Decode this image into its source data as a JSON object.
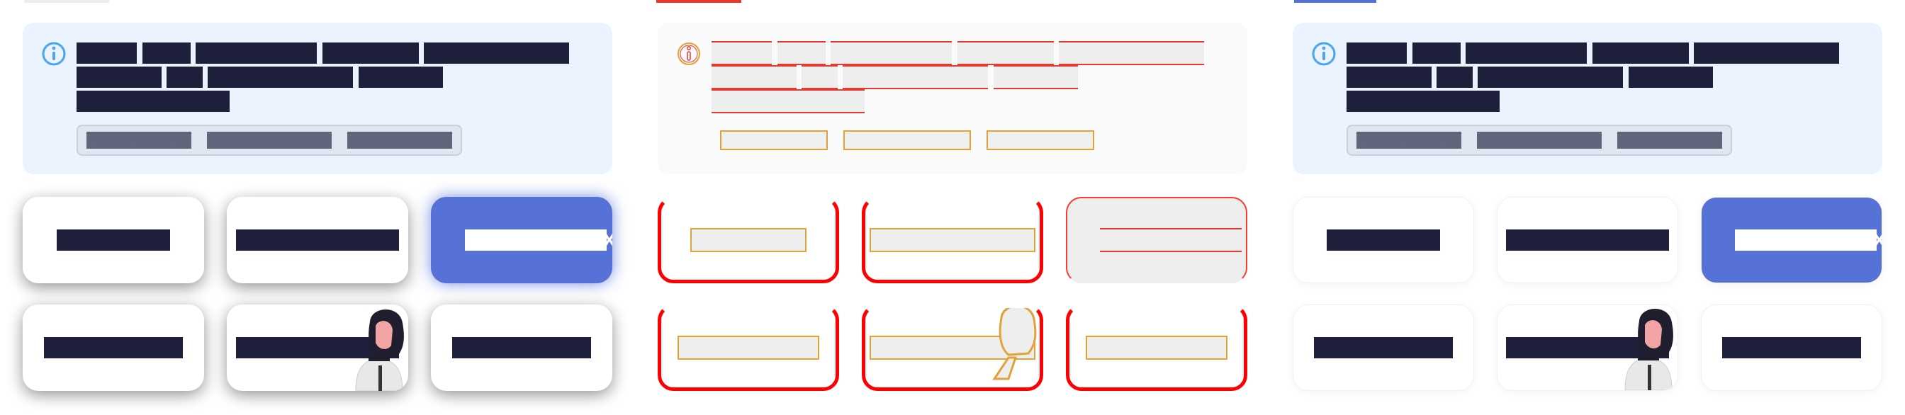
{
  "message_words": [
    "XXXXX",
    "XXXX",
    "XXXXXXXXXX",
    "XXXXXXXX",
    "XXXXXXXXXXXX",
    "XXXXXXX",
    "XXX",
    "XXXXXXXXXXXX",
    "XXXXXXX"
  ],
  "message_lead": "__",
  "message_tail": "XXXXXXXXXXX",
  "chips": [
    "XXXXXXXXXX",
    "XXXXXXXXXXXX",
    "XXXXXXXXXX"
  ],
  "tiles": [
    {
      "label": "XXXXXXXXX",
      "selected": false
    },
    {
      "label": "XXXXXXXXXXXXX",
      "selected": false
    },
    {
      "label": "XXXXXXXXXXXXX",
      "selected": true
    },
    {
      "label": "XXXXXXXXXXX",
      "selected": false
    },
    {
      "label": "XXXXXXXXXXXXX",
      "selected": false
    },
    {
      "label": "XXXXXXXXXXX",
      "selected": false
    }
  ],
  "colors": {
    "info_bg": "#eaf3fe",
    "info_icon": "#4aa3ee",
    "text_dark": "#1d1f3b",
    "chip_text": "#60667b",
    "accent_selected": "#5672d6",
    "diff_red": "#ff0000",
    "diff_orange": "#e2a23a",
    "top_accent_a": "#dddddd",
    "top_accent_b": "#e43a30",
    "top_accent_c": "#5672d6"
  },
  "icons": {
    "info": "info-circle-icon",
    "person": "person-illustration"
  }
}
